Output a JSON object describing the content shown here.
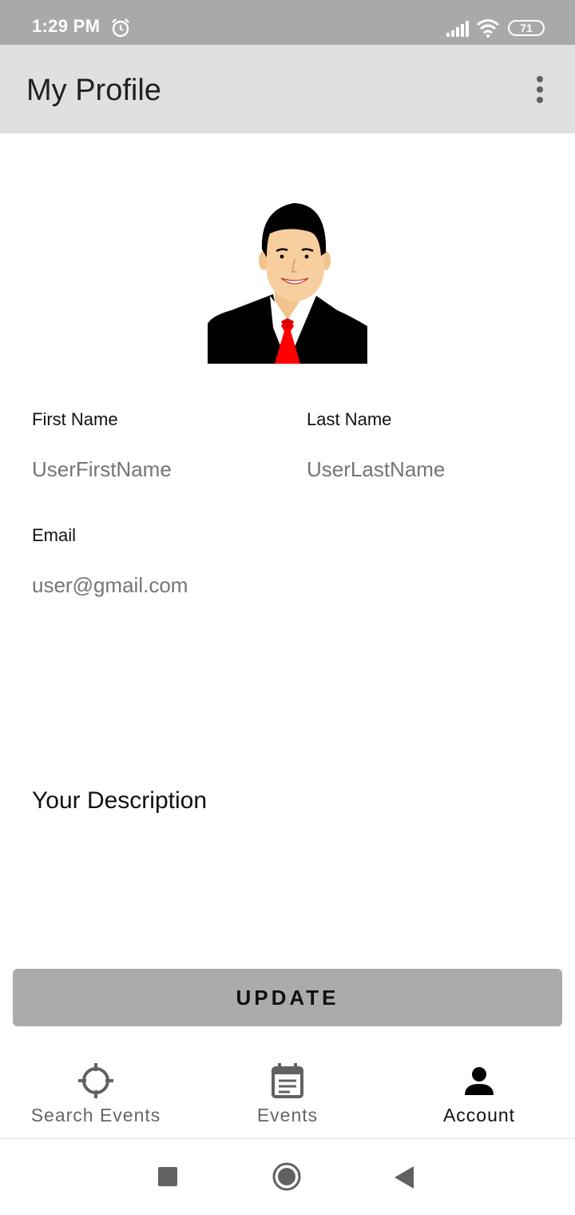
{
  "status_bar": {
    "time": "1:29 PM",
    "battery": "71",
    "icons": [
      "alarm-icon",
      "signal-icon",
      "wifi-icon",
      "battery-icon"
    ]
  },
  "app_bar": {
    "title": "My Profile",
    "menu_icon": "more-vertical-icon"
  },
  "profile": {
    "avatar_icon": "profile-avatar-illustration",
    "first_name_label": "First Name",
    "first_name_placeholder": "UserFirstName",
    "last_name_label": "Last Name",
    "last_name_placeholder": "UserLastName",
    "email_label": "Email",
    "email_placeholder": "user@gmail.com",
    "description_title": "Your Description"
  },
  "actions": {
    "update_label": "UPDATE"
  },
  "bottom_nav": {
    "items": [
      {
        "label": "Search Events",
        "icon": "crosshair-icon",
        "active": false
      },
      {
        "label": "Events",
        "icon": "calendar-icon",
        "active": false
      },
      {
        "label": "Account",
        "icon": "person-icon",
        "active": true
      }
    ]
  },
  "system_nav": {
    "icons": [
      "recents-square-icon",
      "home-circle-icon",
      "back-triangle-icon"
    ]
  },
  "colors": {
    "status_bar": "#a9a9a9",
    "app_bar": "#e0e0e0",
    "button": "#ababab",
    "placeholder": "#bdbdbd",
    "tie": "#ff0000"
  }
}
